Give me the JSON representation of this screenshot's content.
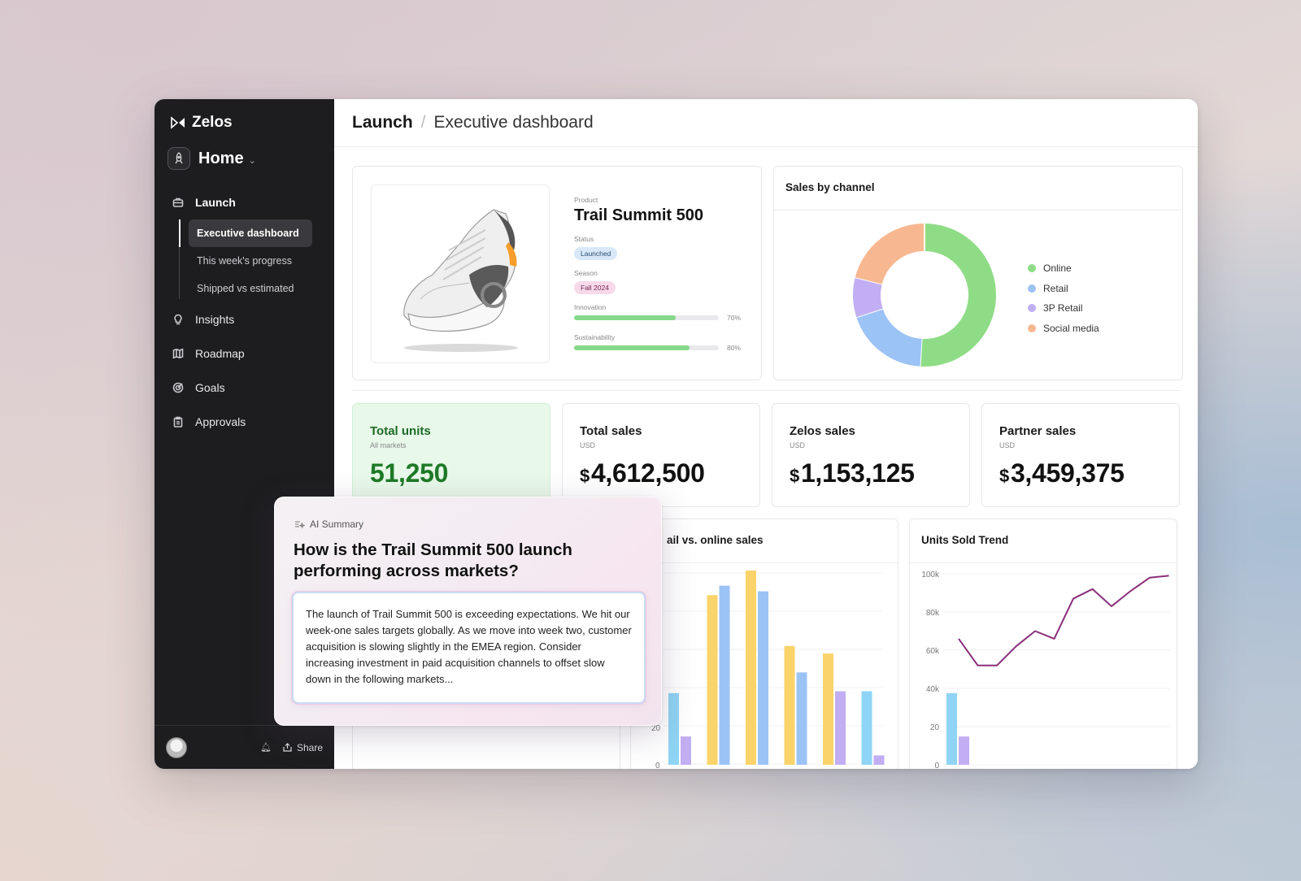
{
  "app": {
    "brand": "Zelos",
    "workspace": "Home"
  },
  "sidebar": {
    "items": [
      {
        "label": "Launch",
        "icon": "briefcase-icon"
      },
      {
        "label": "Insights",
        "icon": "lightbulb-icon"
      },
      {
        "label": "Roadmap",
        "icon": "map-icon"
      },
      {
        "label": "Goals",
        "icon": "target-icon"
      },
      {
        "label": "Approvals",
        "icon": "clipboard-icon"
      }
    ],
    "subitems": [
      "Executive dashboard",
      "This week's progress",
      "Shipped vs estimated"
    ],
    "share_label": "Share"
  },
  "breadcrumb": {
    "section": "Launch",
    "page": "Executive dashboard"
  },
  "product": {
    "product_label": "Product",
    "name": "Trail Summit 500",
    "status_label": "Status",
    "status": "Launched",
    "season_label": "Season",
    "season": "Fall 2024",
    "innovation_label": "Innovation",
    "innovation_pct": "70%",
    "innovation_value": 70,
    "sustainability_label": "Sustainability",
    "sustainability_pct": "80%",
    "sustainability_value": 80
  },
  "sales_by_channel": {
    "title": "Sales by channel",
    "chart_data": {
      "type": "pie",
      "labels": [
        "Online",
        "Retail",
        "3P Retail",
        "Social media"
      ],
      "values": [
        51,
        19,
        9,
        21
      ],
      "colors": [
        "#8fdc86",
        "#9cc3f5",
        "#c2aef2",
        "#f7b891"
      ]
    }
  },
  "stats": [
    {
      "title": "Total units",
      "sub": "All markets",
      "currency": "",
      "value": "51,250"
    },
    {
      "title": "Total sales",
      "sub": "USD",
      "currency": "$",
      "value": "4,612,500"
    },
    {
      "title": "Zelos sales",
      "sub": "USD",
      "currency": "$",
      "value": "1,153,125"
    },
    {
      "title": "Partner sales",
      "sub": "USD",
      "currency": "$",
      "value": "3,459,375"
    }
  ],
  "retail_online": {
    "title": "ail vs. online sales",
    "chart_data": {
      "type": "bar",
      "ytick_labels": [
        "20",
        "0"
      ],
      "groups": [
        [
          {
            "c": "#8fd4f5",
            "v": 38
          },
          {
            "c": "#c2aef2",
            "v": 15
          }
        ],
        [
          {
            "c": "#fad36b",
            "v": 90
          },
          {
            "c": "#9cc3f5",
            "v": 95
          }
        ],
        [
          {
            "c": "#fad36b",
            "v": 103
          },
          {
            "c": "#9cc3f5",
            "v": 92
          }
        ],
        [
          {
            "c": "#fad36b",
            "v": 63
          },
          {
            "c": "#9cc3f5",
            "v": 49
          }
        ],
        [
          {
            "c": "#fad36b",
            "v": 59
          },
          {
            "c": "#c2aef2",
            "v": 39
          }
        ],
        [
          {
            "c": "#8fd4f5",
            "v": 39
          },
          {
            "c": "#c2aef2",
            "v": 5
          }
        ]
      ]
    }
  },
  "units_trend": {
    "title": "Units Sold Trend",
    "chart_data": {
      "type": "line",
      "ytick_labels": [
        "100k",
        "80k",
        "60k",
        "40k",
        "20",
        "0"
      ],
      "ylim": [
        0,
        100
      ],
      "values": [
        66,
        52,
        52,
        62,
        70,
        66,
        87,
        92,
        83,
        91,
        98,
        99
      ],
      "line_color": "#8a2f7a",
      "bars": [
        {
          "c": "#8fd4f5",
          "v": 38
        },
        {
          "c": "#c2aef2",
          "v": 15
        }
      ]
    }
  },
  "ai": {
    "label": "AI Summary",
    "question": "How is the Trail Summit 500 launch performing across markets?",
    "answer": "The launch of Trail Summit 500 is exceeding expectations. We hit our week-one sales targets globally. As we move into week two, customer acquisition is slowing slightly in the EMEA region. Consider increasing investment in paid acquisition channels to offset slow down in the following markets..."
  }
}
